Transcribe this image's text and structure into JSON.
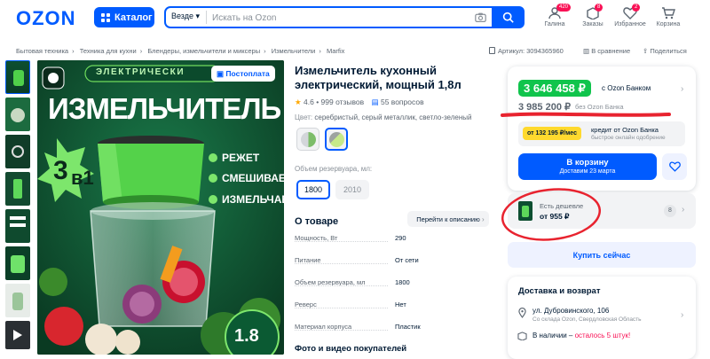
{
  "header": {
    "logo": "OZON",
    "catalog_label": "Каталог",
    "search_scope": "Везде",
    "search_placeholder": "Искать на Ozon",
    "nav": [
      {
        "label": "Галина",
        "badge": "420",
        "icon": "user-icon"
      },
      {
        "label": "Заказы",
        "badge": "8",
        "icon": "box-icon"
      },
      {
        "label": "Избранное",
        "badge": "2",
        "icon": "heart-icon"
      },
      {
        "label": "Корзина",
        "badge": "",
        "icon": "cart-icon"
      }
    ]
  },
  "breadcrumbs": [
    "Бытовая техника",
    "Техника для кухни",
    "Блендеры, измельчители и миксеры",
    "Измельчители",
    "Marfix"
  ],
  "meta": {
    "article": "Артикул: 3094365960",
    "compare": "В сравнение",
    "share": "Поделиться"
  },
  "image_texts": {
    "badge_top": "ЭЛЕКТРИЧЕСКИ",
    "postpay": "Постоплата",
    "headline": "ИЗМЕЛЬЧИТЕЛЬ",
    "three": "3",
    "in_one": "в1",
    "features": [
      "РЕЖЕТ",
      "СМЕШИВАЕТ",
      "ИЗМЕЛЬЧАЕТ"
    ],
    "liters": "1.8"
  },
  "product": {
    "title": "Измельчитель кухонный электрический, мощный 1,8л",
    "rating": "4.6",
    "reviews": "999 отзывов",
    "questions": "55 вопросов",
    "color_label": "Цвет:",
    "color_value": "серебристый, серый металлик, светло-зеленый",
    "volume_label": "Объем резервуара, мл:",
    "volumes": [
      "1800",
      "2010"
    ]
  },
  "about": {
    "heading": "О товаре",
    "goto_description": "Перейти к описанию",
    "specs": [
      {
        "name": "Мощность, Вт",
        "value": "290"
      },
      {
        "name": "Питание",
        "value": "От сети"
      },
      {
        "name": "Объем резервуара, мл",
        "value": "1800"
      },
      {
        "name": "Реверс",
        "value": "Нет"
      },
      {
        "name": "Материал корпуса",
        "value": "Пластик"
      }
    ],
    "media_heading": "Фото и видео покупателей"
  },
  "price": {
    "card_price": "3 646 458 ₽",
    "card_label": "с Ozon Банком",
    "regular_price": "3 985 200 ₽",
    "regular_label": "без Ozon Банка",
    "credit_amount": "от 132 195 ₽/мес",
    "credit_title": "кредит от Ozon Банка",
    "credit_sub": "быстрое онлайн одобрение",
    "cart_label": "В корзину",
    "delivery_date": "Доставим 23 марта"
  },
  "cheaper": {
    "title": "Есть дешевле",
    "price": "от 955 ₽",
    "count": "8"
  },
  "buy_now": "Купить сейчас",
  "delivery": {
    "heading": "Доставка и возврат",
    "address": "ул. Дубровинского, 106",
    "warehouse": "Со склада Ozon, Свердловская Область",
    "stock": "В наличии",
    "left": "осталось 5 штук!"
  },
  "colors": {
    "accent": "#005bff",
    "green": "#10c44c",
    "red_marker": "#e8232f",
    "warning": "#f91155",
    "yellow": "#ffd92e"
  }
}
